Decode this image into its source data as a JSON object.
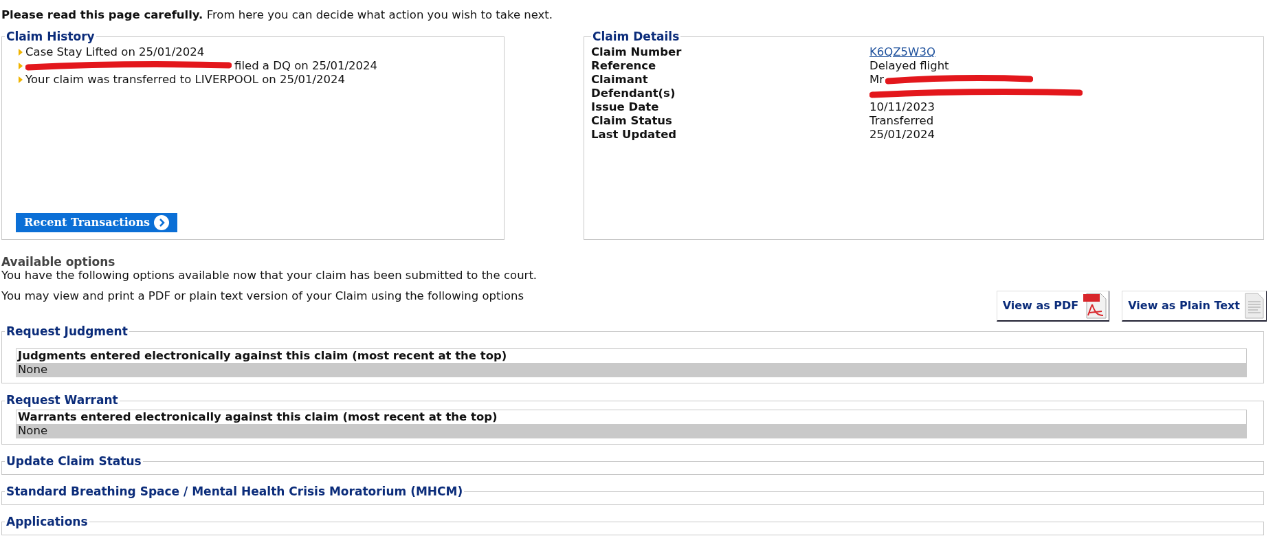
{
  "intro": "**Please read this page carefully.** From here you can decide what action you wish to take next.",
  "claim_history": {
    "title": "Claim History",
    "items": [
      {
        "text": "Case Stay Lifted on 25/01/2024",
        "redacted": false
      },
      {
        "text": "filed a DQ on 25/01/2024",
        "redacted": true
      },
      {
        "text": "Your claim was transferred to LIVERPOOL on 25/01/2024",
        "redacted": false
      }
    ],
    "button": "Recent Transactions"
  },
  "claim_details": {
    "title": "Claim Details",
    "rows": [
      {
        "label": "Claim Number",
        "value": "K6QZ5W3Q",
        "kind": "link",
        "redacted": false
      },
      {
        "label": "Reference",
        "value": "Delayed flight",
        "kind": "text",
        "redacted": false
      },
      {
        "label": "Claimant",
        "value": "Mr",
        "kind": "text",
        "redacted": true
      },
      {
        "label": "Defendant(s)",
        "redacted": true
      },
      {
        "label": "Issue Date",
        "value": "10/11/2023",
        "kind": "text",
        "redacted": false
      },
      {
        "label": "Claim Status",
        "value": "Transferred",
        "kind": "text",
        "redacted": false
      },
      {
        "label": "Last Updated",
        "value": "25/01/2024",
        "kind": "text",
        "redacted": false
      }
    ]
  },
  "available_options": {
    "title": "Available options",
    "text": "You have the following options available now that your claim has been submitted to the court.",
    "view_text": "You may view and print a PDF or plain text version of your Claim using the following options",
    "buttons": [
      {
        "label": "View as PDF",
        "kind": "pdf"
      },
      {
        "label": "View as Plain Text",
        "kind": "text"
      }
    ]
  },
  "sections": [
    {
      "title": "Request Judgment",
      "table": {
        "heading": "Judgments entered electronically against this claim (most recent at the top)",
        "row": "None"
      }
    },
    {
      "title": "Request Warrant",
      "table": {
        "heading": "Warrants entered electronically against this claim (most recent at the top)",
        "row": "None"
      }
    },
    {
      "title": "Update Claim Status"
    },
    {
      "title": "Standard Breathing Space / Mental Health Crisis Moratorium (MHCM)"
    },
    {
      "title": "Applications"
    }
  ]
}
